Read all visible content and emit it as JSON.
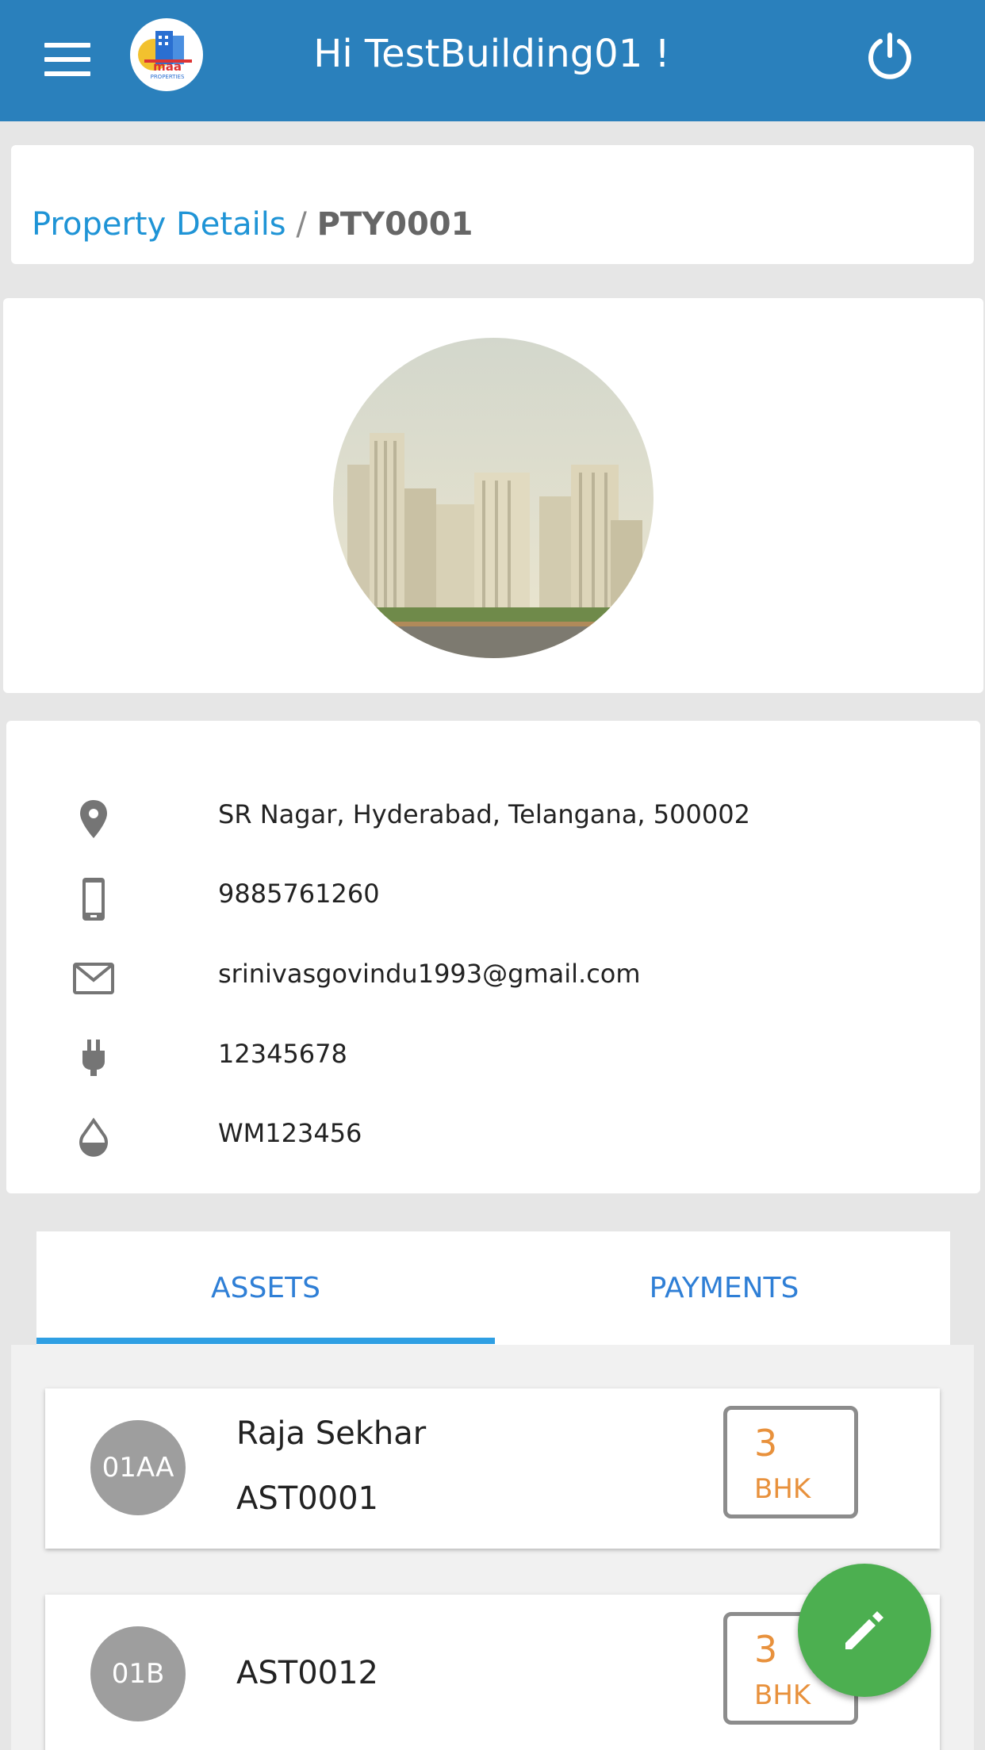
{
  "header": {
    "title": "Hi TestBuilding01 !",
    "logo_text": "maa",
    "logo_subtext": "PROPERTIES",
    "menu_icon": "hamburger-menu-icon",
    "power_icon": "power-icon",
    "background_color": "#2a80bc"
  },
  "breadcrumb": {
    "parent": "Property Details",
    "separator": "/",
    "current": "PTY0001"
  },
  "property_info": [
    {
      "icon": "location-pin-icon",
      "value": "SR Nagar, Hyderabad, Telangana, 500002"
    },
    {
      "icon": "mobile-phone-icon",
      "value": "9885761260"
    },
    {
      "icon": "mail-icon",
      "value": "srinivasgovindu1993@gmail.com"
    },
    {
      "icon": "power-plug-icon",
      "value": "12345678"
    },
    {
      "icon": "water-drop-icon",
      "value": "WM123456"
    }
  ],
  "tabs": [
    {
      "label": "ASSETS",
      "active": true
    },
    {
      "label": "PAYMENTS",
      "active": false
    }
  ],
  "assets": [
    {
      "avatar": "01AA",
      "name": "Raja Sekhar",
      "code": "AST0001",
      "bhk_number": "3",
      "bhk_label": "BHK"
    },
    {
      "avatar": "01B",
      "name": "",
      "code": "AST0012",
      "bhk_number": "3",
      "bhk_label": "BHK"
    }
  ],
  "fab": {
    "icon": "pencil-edit-icon",
    "color": "#4caf50"
  },
  "colors": {
    "link": "#1f94d6",
    "tab_text": "#2f7fd6",
    "tab_indicator": "#2f9fe3",
    "bhk": "#e8913c",
    "avatar": "#9e9e9e"
  }
}
